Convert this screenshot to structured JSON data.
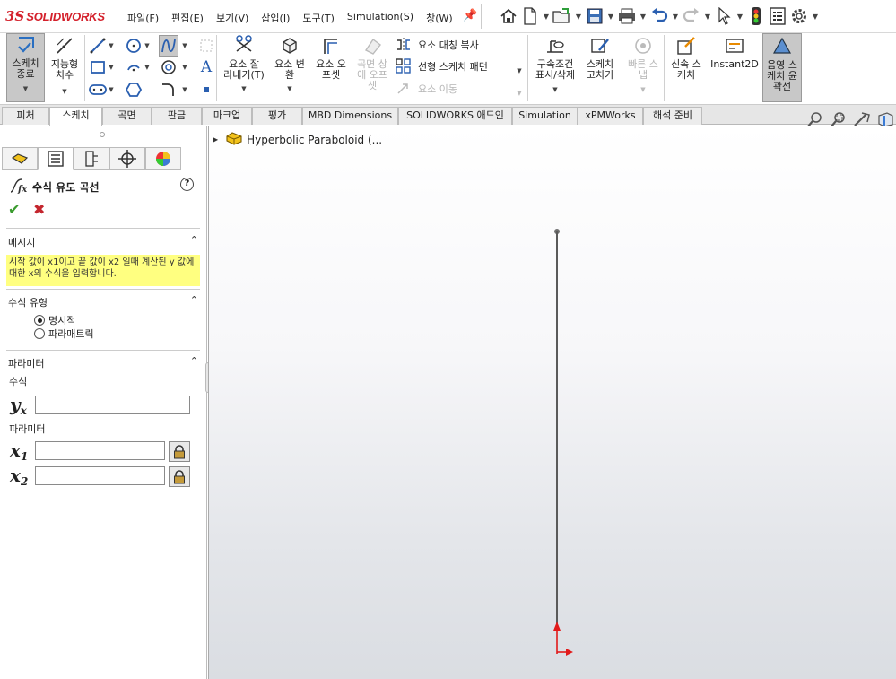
{
  "app": {
    "logo_ds": "3S",
    "logo_text": "SOLIDWORKS",
    "brand_color": "#d4202b"
  },
  "menu": {
    "items": [
      {
        "label": "파일(F)"
      },
      {
        "label": "편집(E)"
      },
      {
        "label": "보기(V)"
      },
      {
        "label": "삽입(I)"
      },
      {
        "label": "도구(T)"
      },
      {
        "label": "Simulation(S)"
      },
      {
        "label": "창(W)"
      }
    ],
    "pin_icon": "pin-icon"
  },
  "quick_access": [
    "home-icon",
    "new-document-icon",
    "open-icon",
    "save-icon",
    "print-icon",
    "undo-icon",
    "redo-icon",
    "select-icon",
    "rebuild-traffic-light-icon",
    "file-properties-icon",
    "options-gear-icon"
  ],
  "ribbon": {
    "exit_sketch": "스케치\n종료",
    "smart_dimension": "지능형\n치수",
    "trim": "요소 잘\n라내기(T)",
    "convert": "요소 변\n환",
    "offset": "요소 오\n프셋",
    "surface_offset": "곡면 상\n에 오프\n셋",
    "mirror": "요소 대칭 복사",
    "linear_pattern": "선형 스케치 패턴",
    "move": "요소 이동",
    "relations": "구속조건\n표시/삭제",
    "repair": "스케치\n고치기",
    "quick_snap": "빠른 스\n냅",
    "rapid_sketch": "신속 스\n케치",
    "instant2d": "Instant2D",
    "shaded_contours": "음영 스\n케치 윤\n곽선"
  },
  "tabs": [
    {
      "label": "피처"
    },
    {
      "label": "스케치",
      "active": true
    },
    {
      "label": "곡면"
    },
    {
      "label": "판금"
    },
    {
      "label": "마크업"
    },
    {
      "label": "평가"
    },
    {
      "label": "MBD Dimensions"
    },
    {
      "label": "SOLIDWORKS 애드인"
    },
    {
      "label": "Simulation"
    },
    {
      "label": "xPMWorks"
    },
    {
      "label": "해석 준비"
    }
  ],
  "property_manager": {
    "title": "수식 유도 곡선",
    "help": "?",
    "ok": "✔",
    "cancel": "✖",
    "message_header": "메시지",
    "message_text": "시작 값이 x1이고 끝 값이 x2 일때 계산된 y 값에 대한 x의 수식을 입력합니다.",
    "equation_type_header": "수식 유형",
    "option_explicit": "명시적",
    "option_parametric": "파라매트릭",
    "selected_option": "explicit",
    "parameters_header": "파라미터",
    "equation_label": "수식",
    "yx_symbol": "y",
    "yx_sub": "x",
    "yx_value": "",
    "params_label": "파라미터",
    "x1_symbol": "x",
    "x1_sub": "1",
    "x1_value": "",
    "x2_symbol": "x",
    "x2_sub": "2",
    "x2_value": ""
  },
  "feature_tree": {
    "root_label": "Hyperbolic Paraboloid (..."
  }
}
